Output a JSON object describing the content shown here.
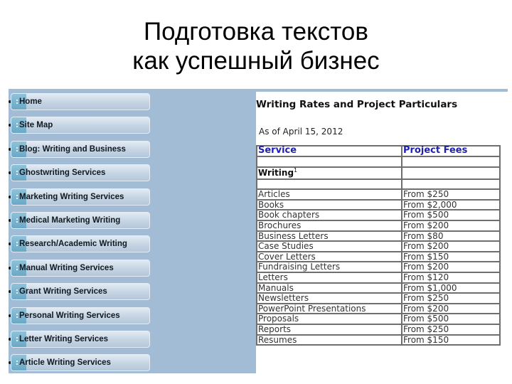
{
  "slide": {
    "title_line1": "Подготовка текстов",
    "title_line2": "как успешный бизнес"
  },
  "sidebar": {
    "items": [
      {
        "label": "Home"
      },
      {
        "label": "Site Map"
      },
      {
        "label": "Blog: Writing and Business"
      },
      {
        "label": "Ghostwriting Services"
      },
      {
        "label": "Marketing Writing Services"
      },
      {
        "label": "Medical Marketing Writing"
      },
      {
        "label": "Research/Academic Writing"
      },
      {
        "label": "Manual Writing Services"
      },
      {
        "label": "Grant Writing Services"
      },
      {
        "label": "Personal Writing Services"
      },
      {
        "label": "Letter Writing Services"
      },
      {
        "label": "Article Writing Services"
      }
    ]
  },
  "content": {
    "heading": "Writing Rates and Project Particulars",
    "date": "As of April 15, 2012",
    "table": {
      "headers": [
        "Service",
        "Project Fees"
      ],
      "section_label": "Writing",
      "section_footnote": "1",
      "rows": [
        {
          "service": "Articles",
          "fee": "From $250"
        },
        {
          "service": "Books",
          "fee": "From $2,000"
        },
        {
          "service": "Book chapters",
          "fee": "From $500"
        },
        {
          "service": "Brochures",
          "fee": "From $200"
        },
        {
          "service": "Business Letters",
          "fee": "From $80"
        },
        {
          "service": "Case Studies",
          "fee": "From $200"
        },
        {
          "service": "Cover Letters",
          "fee": "From $150"
        },
        {
          "service": "Fundraising Letters",
          "fee": "From $200"
        },
        {
          "service": "Letters",
          "fee": "From $120"
        },
        {
          "service": "Manuals",
          "fee": "From $1,000"
        },
        {
          "service": "Newsletters",
          "fee": "From $250"
        },
        {
          "service": "PowerPoint Presentations",
          "fee": "From $200"
        },
        {
          "service": "Proposals",
          "fee": "From $500"
        },
        {
          "service": "Reports",
          "fee": "From $250"
        },
        {
          "service": "Resumes",
          "fee": "From $150"
        }
      ]
    }
  },
  "colors": {
    "page_bg": "#a3bcd6",
    "header_link": "#1f1fb4",
    "nav_tab": "#6aa8c6"
  }
}
